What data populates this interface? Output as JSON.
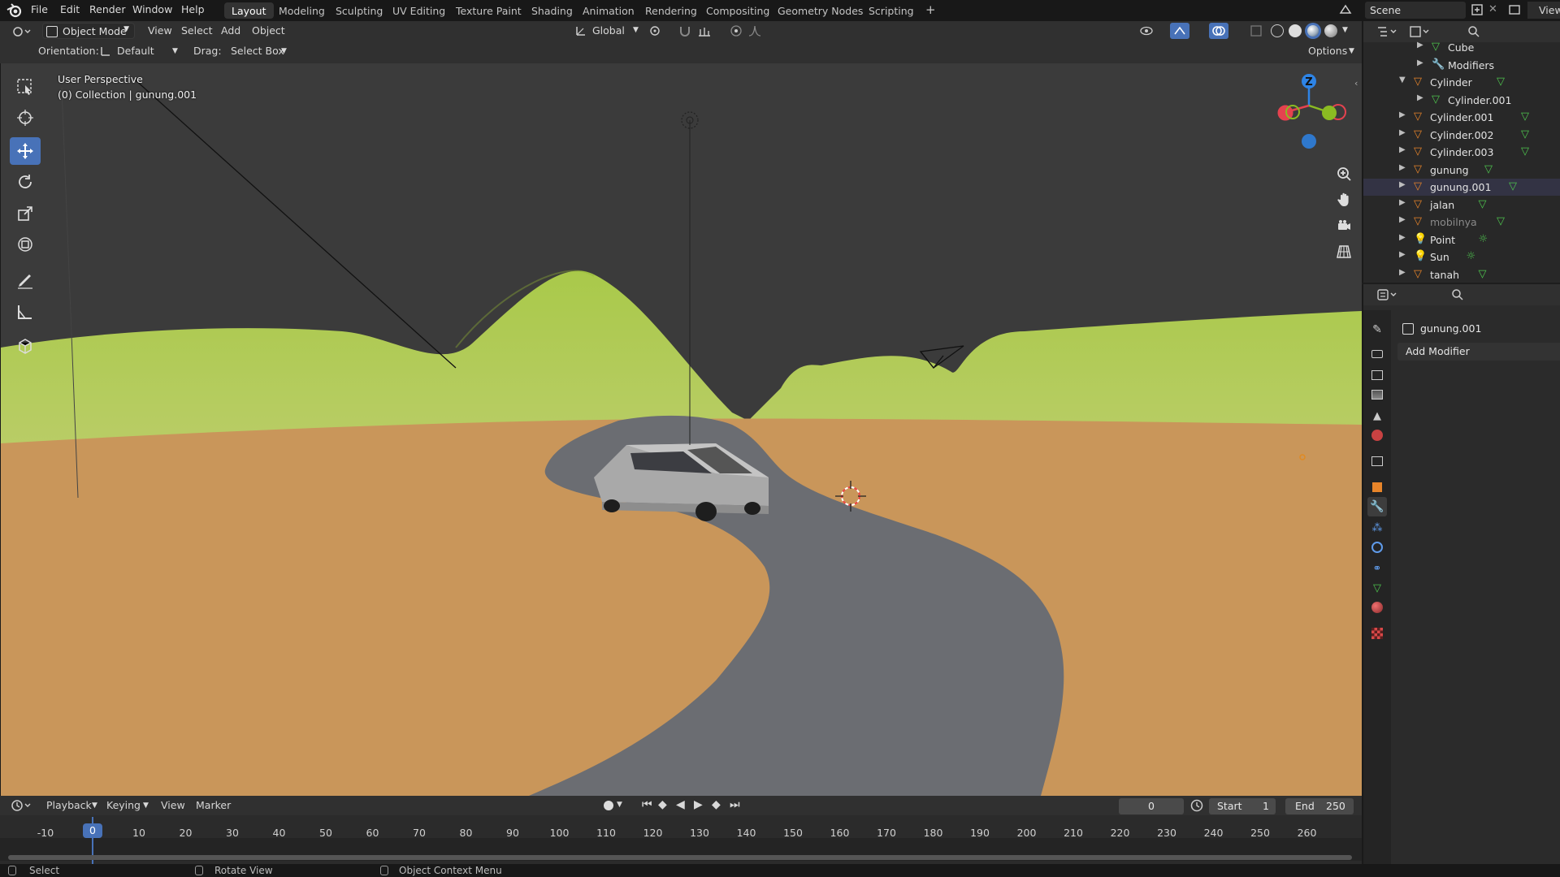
{
  "menu": {
    "items": [
      "File",
      "Edit",
      "Render",
      "Window",
      "Help"
    ],
    "workspaces": [
      "Layout",
      "Modeling",
      "Sculpting",
      "UV Editing",
      "Texture Paint",
      "Shading",
      "Animation",
      "Rendering",
      "Compositing",
      "Geometry Nodes",
      "Scripting"
    ],
    "active_workspace": "Layout",
    "add_workspace": "+",
    "scene": "Scene",
    "view_layer": "View"
  },
  "viewport_header": {
    "mode": "Object Mode",
    "menus": [
      "View",
      "Select",
      "Add",
      "Object"
    ],
    "transform_orientation": "Global",
    "orientation_label": "Orientation:",
    "orientation_value": "Default",
    "drag_label": "Drag:",
    "drag_value": "Select Box",
    "options": "Options"
  },
  "viewport": {
    "view_name": "User Perspective",
    "collection_info": "(0) Collection | gunung.001",
    "gizmo_axis_label": "Z",
    "colors": {
      "grass": "#b7c95a",
      "sand": "#c9965a",
      "road": "#6b6d72",
      "sky": "#3b3b3b"
    }
  },
  "timeline": {
    "menus": [
      "Playback",
      "Keying",
      "View",
      "Marker"
    ],
    "current_frame": "0",
    "start_label": "Start",
    "start": "1",
    "end_label": "End",
    "end": "250",
    "ruler": [
      "-10",
      "0",
      "10",
      "20",
      "30",
      "40",
      "50",
      "60",
      "70",
      "80",
      "90",
      "100",
      "110",
      "120",
      "130",
      "140",
      "150",
      "160",
      "170",
      "180",
      "190",
      "200",
      "210",
      "220",
      "230",
      "240",
      "250",
      "260"
    ],
    "playhead_frame": "0"
  },
  "outliner": {
    "items": [
      {
        "name": "Cube",
        "icon": "mesh-data-icon",
        "indent": 2
      },
      {
        "name": "Modifiers",
        "icon": "wrench-icon",
        "indent": 2
      },
      {
        "name": "Cylinder",
        "icon": "mesh-object-icon",
        "indent": 1
      },
      {
        "name": "Cylinder.001",
        "icon": "mesh-data-icon",
        "indent": 2
      },
      {
        "name": "Cylinder.001",
        "icon": "mesh-object-icon",
        "indent": 1
      },
      {
        "name": "Cylinder.002",
        "icon": "mesh-object-icon",
        "indent": 1
      },
      {
        "name": "Cylinder.003",
        "icon": "mesh-object-icon",
        "indent": 1
      },
      {
        "name": "gunung",
        "icon": "mesh-object-icon",
        "indent": 1
      },
      {
        "name": "gunung.001",
        "icon": "mesh-object-icon",
        "indent": 1
      },
      {
        "name": "jalan",
        "icon": "mesh-object-icon",
        "indent": 1
      },
      {
        "name": "mobilnya",
        "icon": "mesh-object-icon",
        "indent": 1
      },
      {
        "name": "Point",
        "icon": "light-icon",
        "indent": 1
      },
      {
        "name": "Sun",
        "icon": "light-icon",
        "indent": 1
      },
      {
        "name": "tanah",
        "icon": "mesh-object-icon",
        "indent": 1
      }
    ]
  },
  "properties": {
    "object_name": "gunung.001",
    "add_modifier": "Add Modifier"
  },
  "statusbar": {
    "items": [
      "Select",
      "Rotate View",
      "Object Context Menu"
    ]
  }
}
